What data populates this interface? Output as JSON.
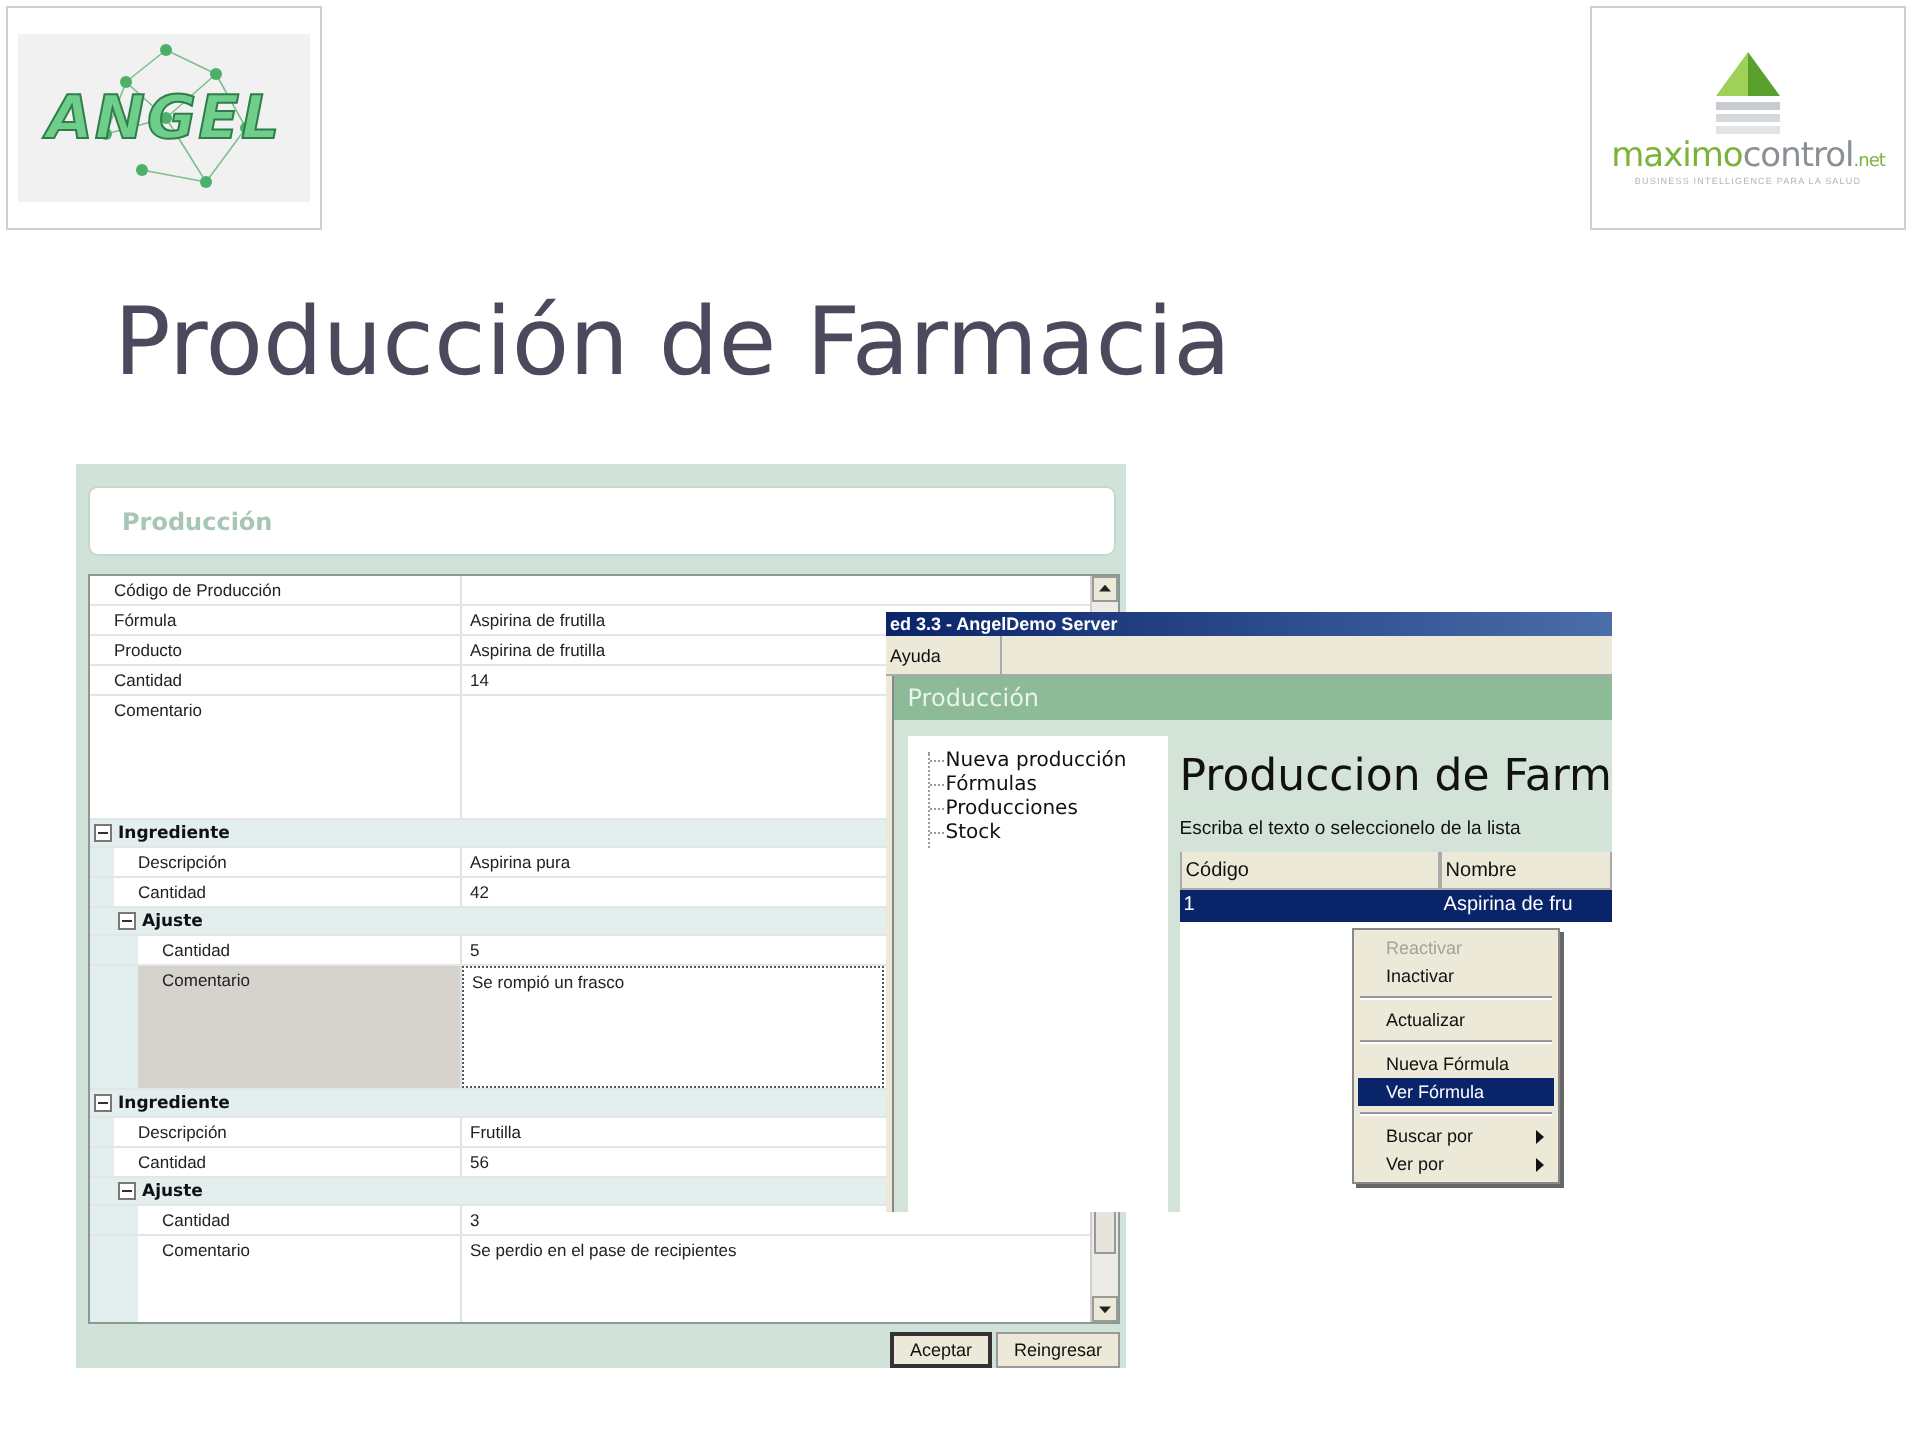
{
  "slide": {
    "title": "Producción de Farmacia"
  },
  "logos": {
    "left": {
      "text": "ANGEL"
    },
    "right": {
      "part_1": "maximo",
      "part_2": "control",
      "suffix": ".net",
      "tagline": "BUSINESS INTELLIGENCE PARA LA SALUD"
    }
  },
  "form_window": {
    "title": "Producción",
    "fields": [
      {
        "label": "Código de Producción",
        "kind": "line",
        "selected": false
      },
      {
        "label": "Fórmula",
        "value": "Aspirina de frutilla",
        "kind": "line",
        "selected": false
      },
      {
        "label": "Producto",
        "value": "Aspirina de frutilla",
        "kind": "line",
        "selected": false
      },
      {
        "label": "Cantidad",
        "value": "14",
        "kind": "line",
        "selected": false
      },
      {
        "label": "Comentario",
        "kind": "memo",
        "selected": false
      }
    ],
    "sections": [
      {
        "title": "Ingrediente",
        "expanded": true,
        "fields": [
          {
            "label": "Descripción",
            "value": "Aspirina pura",
            "kind": "line",
            "selected": false
          },
          {
            "label": "Cantidad",
            "value": "42",
            "kind": "line",
            "selected": false
          }
        ],
        "subsections": [
          {
            "title": "Ajuste",
            "expanded": true,
            "fields": [
              {
                "label": "Cantidad",
                "value": "5",
                "kind": "line",
                "selected": false
              },
              {
                "label": "Comentario",
                "value": "Se rompió un frasco",
                "kind": "memo",
                "selected": true
              }
            ]
          }
        ]
      },
      {
        "title": "Ingrediente",
        "expanded": true,
        "fields": [
          {
            "label": "Descripción",
            "value": "Frutilla",
            "kind": "line",
            "selected": false
          },
          {
            "label": "Cantidad",
            "value": "56",
            "kind": "line",
            "selected": false
          }
        ],
        "subsections": [
          {
            "title": "Ajuste",
            "expanded": true,
            "fields": [
              {
                "label": "Cantidad",
                "value": "3",
                "kind": "line",
                "selected": false
              },
              {
                "label": "Comentario",
                "value": "Se perdio en el pase de recipientes",
                "kind": "memo",
                "selected": false
              }
            ]
          }
        ]
      }
    ],
    "buttons": [
      {
        "label": "Aceptar",
        "default": true
      },
      {
        "label": "Reingresar",
        "default": false
      }
    ]
  },
  "list_window": {
    "title": "ed 3.3 - AngelDemo Server",
    "menu": [
      "Ayuda"
    ],
    "panel_title": "Producción",
    "tree": [
      "Nueva producción",
      "Fórmulas",
      "Producciones",
      "Stock"
    ],
    "heading": "Produccion de Farm",
    "prompt": "Escriba el texto o seleccionelo de la lista",
    "table": {
      "columns": [
        "Código",
        "Nombre"
      ],
      "rows": [
        {
          "cells": [
            "1",
            "Aspirina de fru"
          ],
          "selected": true
        }
      ]
    },
    "context_menu": [
      [
        {
          "label": "Reactivar",
          "disabled": true,
          "selected": false,
          "submenu": false
        },
        {
          "label": "Inactivar",
          "disabled": false,
          "selected": false,
          "submenu": false
        }
      ],
      [
        {
          "label": "Actualizar",
          "disabled": false,
          "selected": false,
          "submenu": false
        }
      ],
      [
        {
          "label": "Nueva Fórmula",
          "disabled": false,
          "selected": false,
          "submenu": false
        },
        {
          "label": "Ver Fórmula",
          "disabled": false,
          "selected": true,
          "submenu": false
        }
      ],
      [
        {
          "label": "Buscar por",
          "disabled": false,
          "selected": false,
          "submenu": true
        },
        {
          "label": "Ver por",
          "disabled": false,
          "selected": false,
          "submenu": true
        }
      ]
    ]
  }
}
